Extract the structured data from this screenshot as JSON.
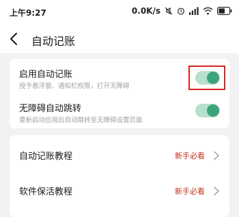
{
  "status_bar": {
    "time": "上午9:27",
    "network_speed": "0.0K/s",
    "battery_level": 0.6
  },
  "header": {
    "title": "自动记账"
  },
  "settings": [
    {
      "title": "启用自动记账",
      "description": "授予悬浮窗、通知栏权限，打开无障碍",
      "enabled": true
    },
    {
      "title": "无障碍自动跳转",
      "description": "重新启动应用后自动跳转至无障碍设置页面",
      "enabled": true
    }
  ],
  "tutorials": [
    {
      "title": "自动记账教程",
      "badge": "新手必看"
    },
    {
      "title": "软件保活教程",
      "badge": "新手必看"
    }
  ],
  "colors": {
    "toggle_on_track": "#b9dfcd",
    "toggle_on_knob": "#3aa57a",
    "badge": "#c4321f",
    "highlight": "#d9231d"
  }
}
